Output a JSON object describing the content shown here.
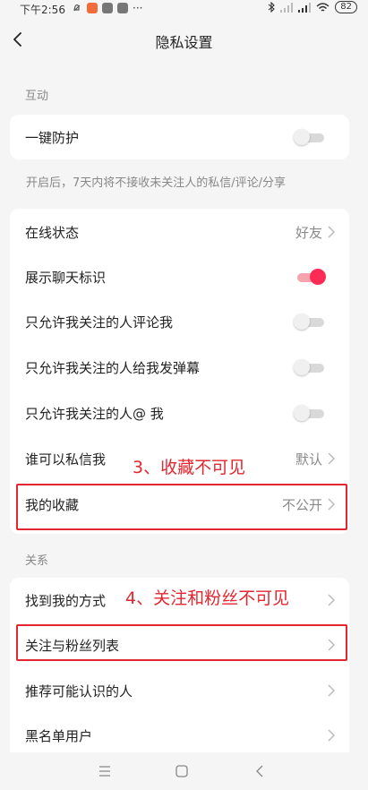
{
  "status_bar": {
    "time": "下午2:56",
    "battery": "82"
  },
  "header": {
    "title": "隐私设置"
  },
  "sections": {
    "interaction": "互动",
    "relations": "关系"
  },
  "one_key_protect": {
    "label": "一键防护",
    "enabled": false,
    "hint": "开启后，7天内将不接收未关注人的私信/评论/分享"
  },
  "settings": {
    "online_status": {
      "label": "在线状态",
      "value": "好友"
    },
    "show_chat_badge": {
      "label": "展示聊天标识",
      "enabled": true
    },
    "comment_only_following": {
      "label": "只允许我关注的人评论我",
      "enabled": false
    },
    "danmaku_only_following": {
      "label": "只允许我关注的人给我发弹幕",
      "enabled": false
    },
    "mention_only_following": {
      "label": "只允许我关注的人@ 我",
      "enabled": false
    },
    "who_can_message": {
      "label": "谁可以私信我",
      "value": "默认"
    },
    "my_favorites": {
      "label": "我的收藏",
      "value": "不公开"
    }
  },
  "relations": {
    "find_me": {
      "label": "找到我的方式"
    },
    "follow_fans_list": {
      "label": "关注与粉丝列表"
    },
    "recommend_people": {
      "label": "推荐可能认识的人"
    },
    "blacklist": {
      "label": "黑名单用户"
    }
  },
  "annotations": {
    "note3": "3、收藏不可见",
    "note4": "4、关注和粉丝不可见"
  },
  "colors": {
    "accent": "#fe2c55",
    "annotation": "#e3262f"
  }
}
